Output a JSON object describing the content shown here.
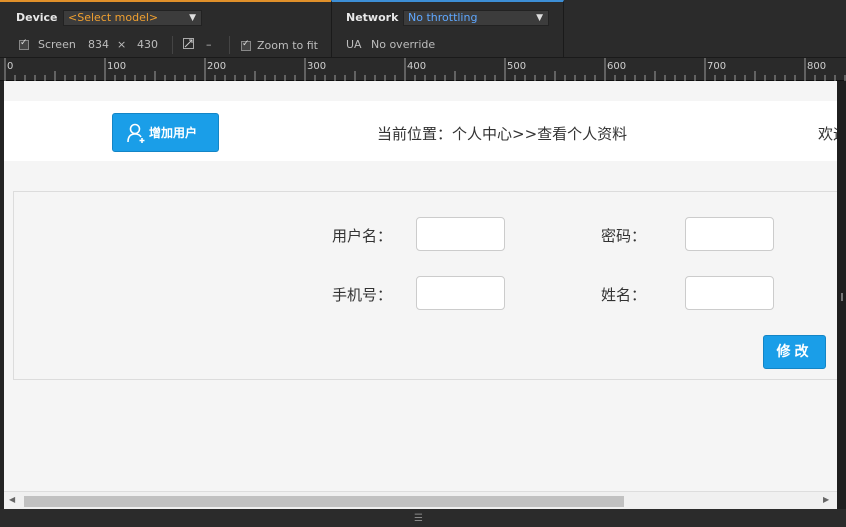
{
  "devtools": {
    "device_label": "Device",
    "model_select": "<Select model>",
    "screen_label": "Screen",
    "screen_width": "834",
    "screen_times": "×",
    "screen_height": "430",
    "pixel_ratio": "–",
    "zoom_label": "Zoom to fit",
    "network_label": "Network",
    "throttle_select": "No throttling",
    "ua_label": "UA",
    "ua_value": "No override",
    "select_arrow": "▼"
  },
  "ruler": {
    "labels": [
      "0",
      "100",
      "200",
      "300",
      "400",
      "500",
      "600",
      "700",
      "800"
    ]
  },
  "page": {
    "add_user_button": "增加用户",
    "breadcrumb": "当前位置：个人中心>>查看个人资料",
    "welcome": "欢迎",
    "form": {
      "username_label": "用户名：",
      "password_label": "密码：",
      "phone_label": "手机号：",
      "name_label": "姓名：",
      "submit_button": "修改"
    }
  },
  "scroll": {
    "left_arrow": "◀",
    "right_arrow": "▶",
    "resize_handle": "☰"
  },
  "colors": {
    "accent_orange": "#e0902a",
    "accent_blue": "#3d8fd6",
    "button_blue": "#1a9ee8"
  }
}
